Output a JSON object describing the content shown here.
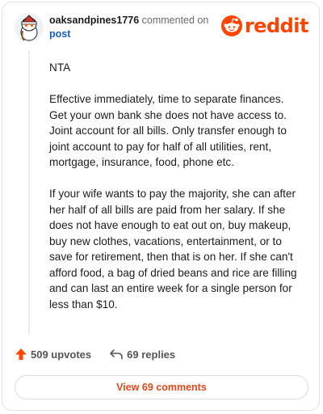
{
  "comment": {
    "username": "oaksandpines1776",
    "action_text": "commented on",
    "post_link": "post",
    "paragraphs": [
      "NTA",
      "Effective immediately, time to separate finances. Get your own bank she does not have access to. Joint account for all bills. Only transfer enough to joint account to pay for half of all utilities, rent, mortgage, insurance, food, phone etc.",
      "If your wife wants to pay the majority, she can after her half of all bills are paid from her salary. If she does not have enough to eat out on, buy makeup, buy new clothes, vacations, entertainment, or to save for retirement, then that is on her. If she can't afford food, a bag of dried beans and rice are filling and can last an entire week for a single person for less than $10."
    ]
  },
  "brand": {
    "logo_text": "reddit",
    "accent_color": "#ff4500"
  },
  "actions": {
    "upvotes": "509 upvotes",
    "replies": "69 replies"
  },
  "footer": {
    "view_comments": "View 69 comments"
  },
  "icons": {
    "avatar": "avatar",
    "logo": "reddit-snoo-icon",
    "upvote": "upvote-arrow-icon",
    "reply": "reply-arrow-icon"
  }
}
